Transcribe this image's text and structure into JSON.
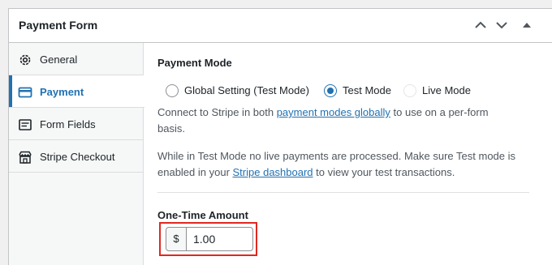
{
  "header": {
    "title": "Payment Form",
    "buttons": [
      {
        "icon": "chevron-up-icon"
      },
      {
        "icon": "chevron-down-icon"
      },
      {
        "icon": "caret-up-icon"
      }
    ]
  },
  "sidebar": {
    "items": [
      {
        "label": "General",
        "icon": "gear-icon",
        "active": false
      },
      {
        "label": "Payment",
        "icon": "credit-card-icon",
        "active": true
      },
      {
        "label": "Form Fields",
        "icon": "document-icon",
        "active": false
      },
      {
        "label": "Stripe Checkout",
        "icon": "storefront-icon",
        "active": false
      }
    ]
  },
  "payment": {
    "mode_title": "Payment Mode",
    "modes": [
      {
        "label": "Global Setting (Test Mode)",
        "checked": false
      },
      {
        "label": "Test Mode",
        "checked": true
      },
      {
        "label": "Live Mode",
        "checked": false
      }
    ],
    "desc1_before": "Connect to Stripe in both ",
    "desc1_link": "payment modes globally",
    "desc1_middle": " to use on a per-form",
    "desc1_after": "basis.",
    "desc2_line1": "While in Test Mode no live payments are processed. Make sure Test mode is",
    "desc2_before": "enabled in your ",
    "desc2_link": "Stripe dashboard",
    "desc2_after": " to view your test transactions.",
    "amount_title": "One-Time Amount",
    "currency_symbol": "$",
    "amount_value": "1.00"
  },
  "colors": {
    "accent": "#2271b1",
    "highlight": "#e0281f"
  }
}
